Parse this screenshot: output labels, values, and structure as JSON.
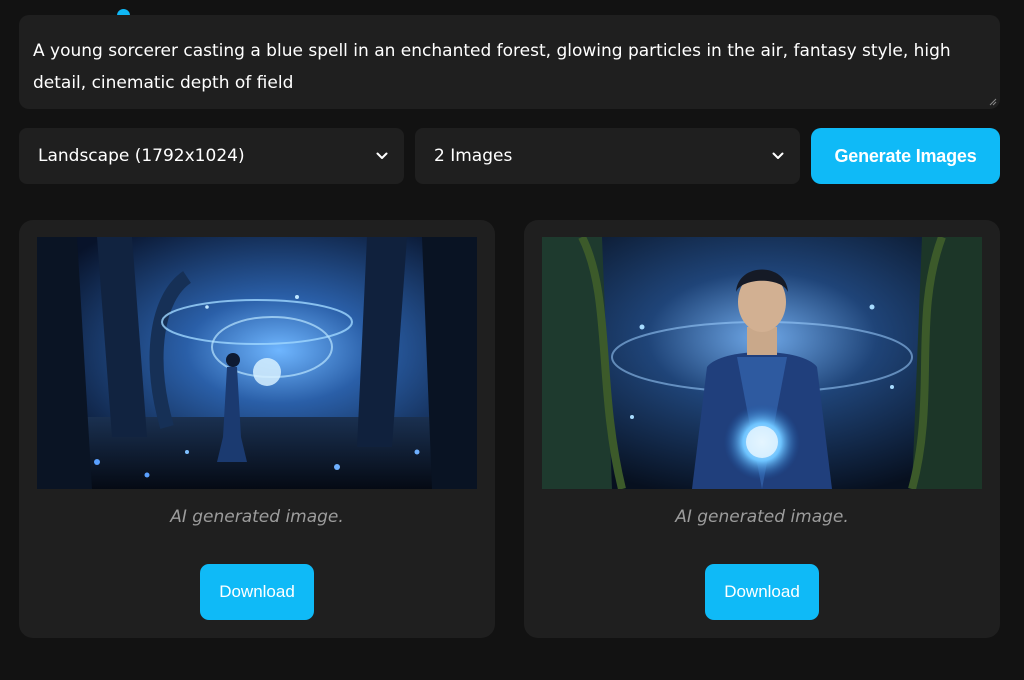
{
  "prompt": {
    "value": "A young sorcerer casting a blue spell in an enchanted forest, glowing particles in the air, fantasy style, high detail, cinematic depth of field"
  },
  "size_select": {
    "selected": "Landscape (1792x1024)"
  },
  "count_select": {
    "selected": "2 Images"
  },
  "generate_button": {
    "label": "Generate Images"
  },
  "results": [
    {
      "caption": "AI generated image.",
      "download_label": "Download"
    },
    {
      "caption": "AI generated image.",
      "download_label": "Download"
    }
  ],
  "icons": {
    "select_arrow": "chevron-down-icon"
  },
  "colors": {
    "accent": "#0fbaf7",
    "background": "#121212",
    "panel": "#1f1f1f",
    "caption": "#9c9c9c"
  }
}
